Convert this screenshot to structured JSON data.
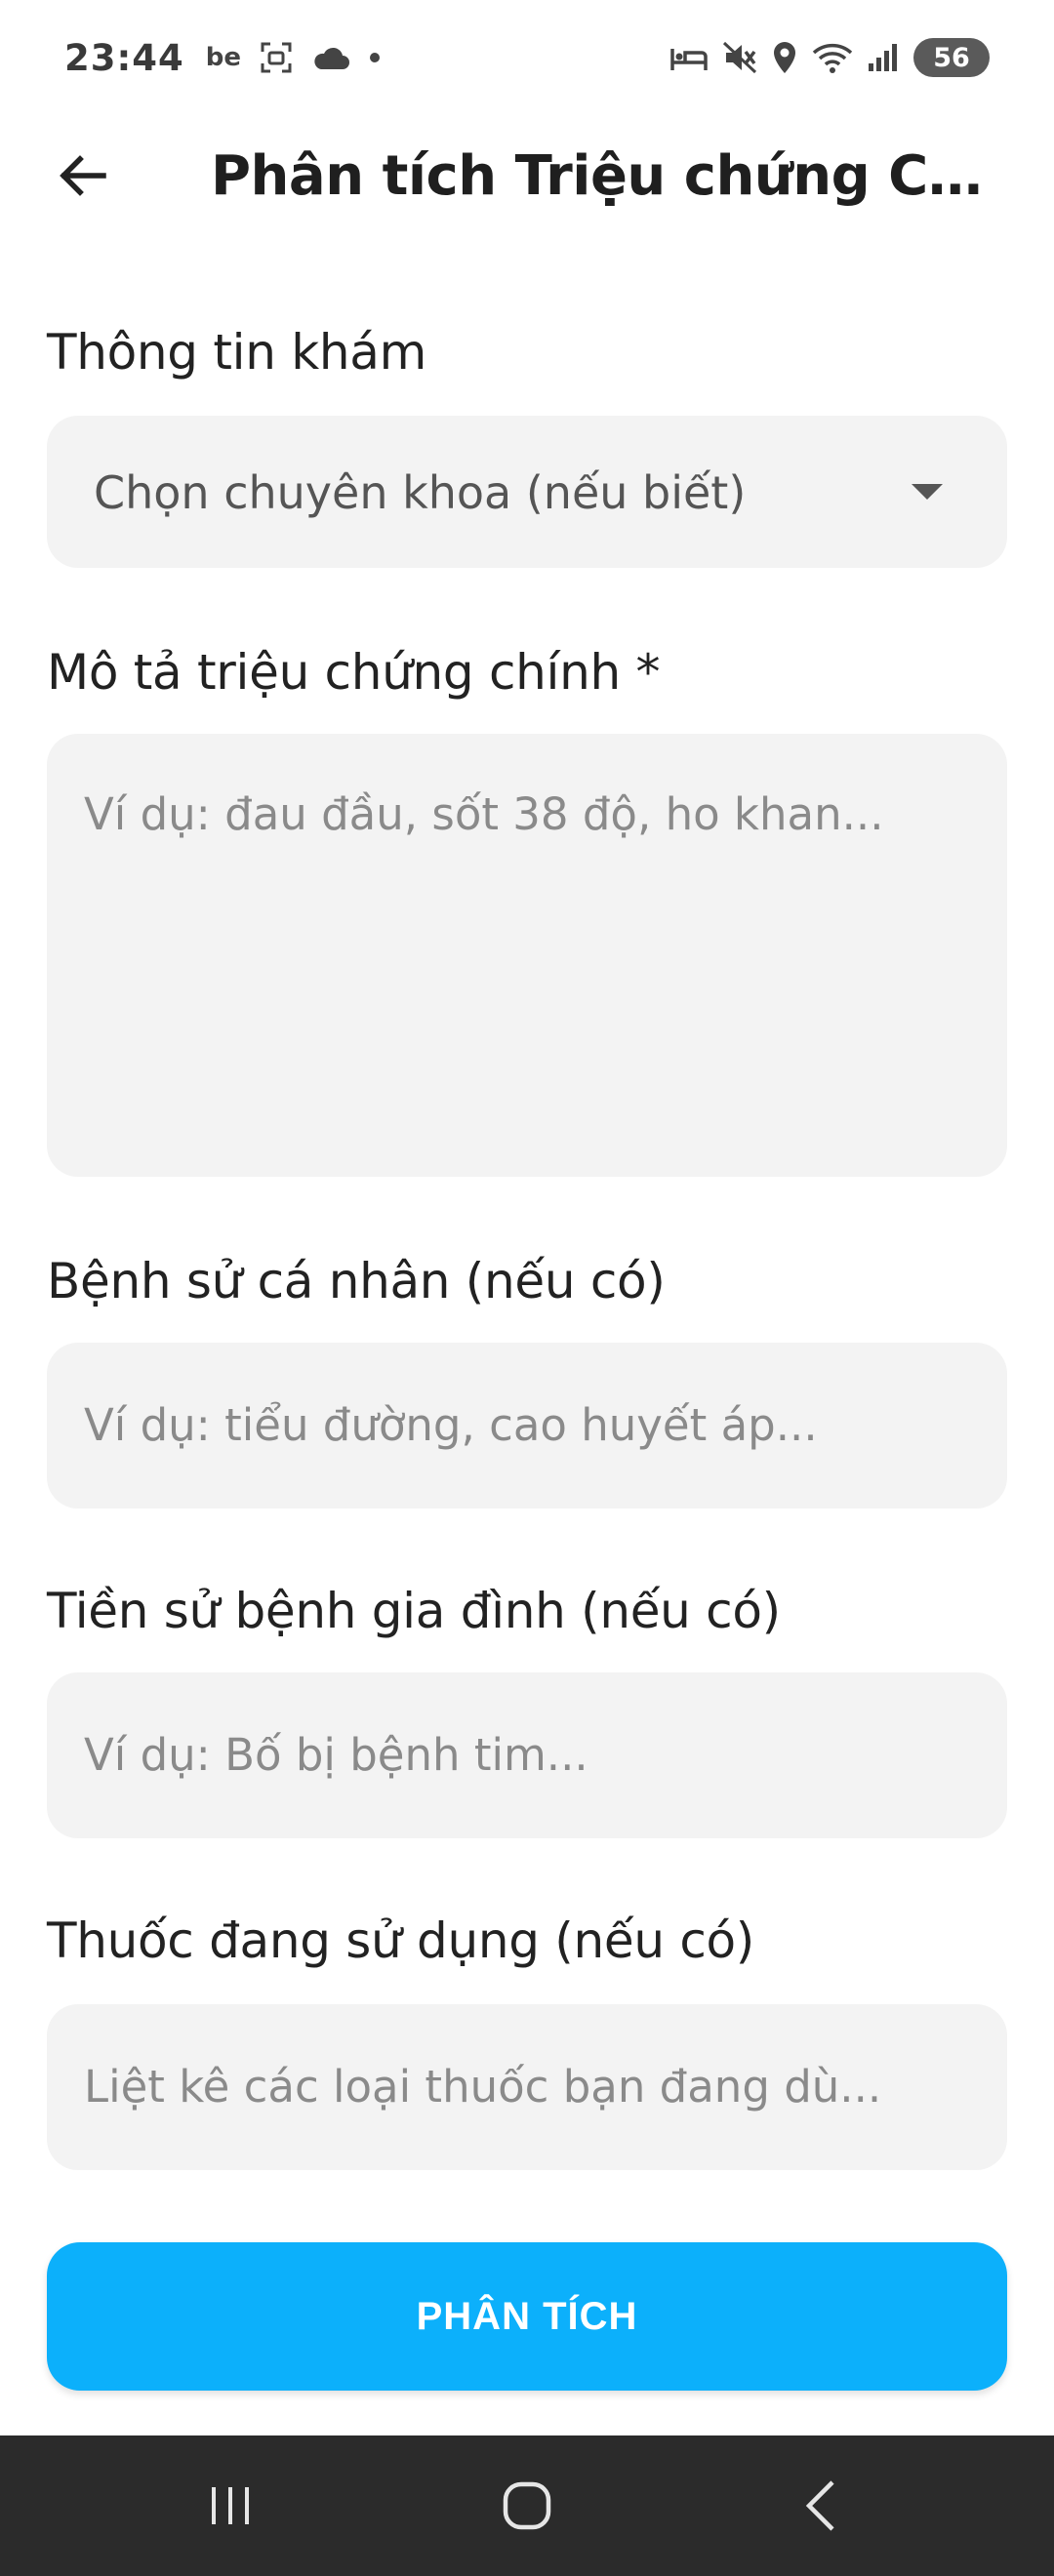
{
  "status_bar": {
    "time": "23:44",
    "left_icons": [
      "be-icon",
      "screenshot-icon",
      "cloud-icon",
      "dot-icon"
    ],
    "right_icons": [
      "bed-icon",
      "mute-icon",
      "location-icon",
      "wifi-icon",
      "signal-icon"
    ],
    "battery": "56"
  },
  "app_bar": {
    "title": "Phân tích Triệu chứng Chi..."
  },
  "form": {
    "section_title": "Thông tin khám",
    "specialty_select": {
      "selected": "Chọn chuyên khoa (nếu biết)"
    },
    "symptoms": {
      "label": "Mô tả triệu chứng chính *",
      "placeholder": "Ví dụ: đau đầu, sốt 38 độ, ho khan..."
    },
    "personal_history": {
      "label": "Bệnh sử cá nhân (nếu có)",
      "placeholder": "Ví dụ: tiểu đường, cao huyết áp..."
    },
    "family_history": {
      "label": "Tiền sử bệnh gia đình (nếu có)",
      "placeholder": "Ví dụ: Bố bị bệnh tim..."
    },
    "medications": {
      "label": "Thuốc đang sử dụng (nếu có)",
      "placeholder": "Liệt kê các loại thuốc bạn đang dù..."
    },
    "submit_label": "PHÂN TÍCH"
  },
  "colors": {
    "accent": "#0cb0fb",
    "field_bg": "#f3f3f3",
    "nav_bg": "#2b2b2b"
  }
}
